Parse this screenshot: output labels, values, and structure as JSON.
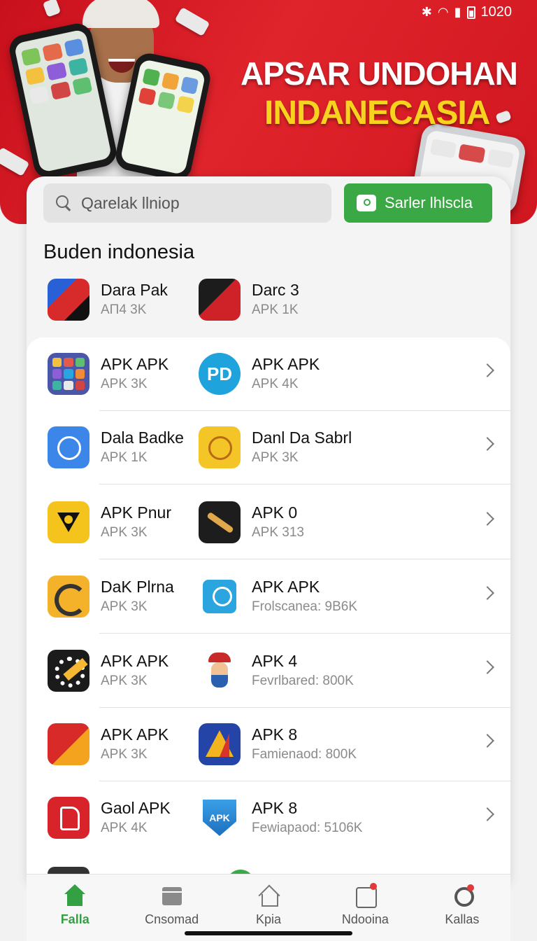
{
  "status_bar": {
    "time": "1020",
    "bluetooth_icon": "bluetooth-icon",
    "wifi_icon": "wifi-icon",
    "signal_icon": "signal-icon",
    "battery_icon": "battery-icon"
  },
  "hero": {
    "title": "APSAR UNDOHAN",
    "subtitle": "INDANECASIA",
    "accent_color": "#f7d21e",
    "background_color": "#d8161f"
  },
  "search": {
    "placeholder": "Qarelak llniop",
    "button_label": "Sarler lhlscla",
    "button_color": "#3aa844"
  },
  "section": {
    "title": "Buden indonesia"
  },
  "featured": [
    {
      "name": "Dara Pak",
      "meta": "AП4 3K",
      "icon": "red-blue-shape-icon"
    },
    {
      "name": "Darc 3",
      "meta": "APK 1K",
      "icon": "dark-red-app-icon"
    }
  ],
  "rows": [
    {
      "left": {
        "name": "APK APK",
        "meta": "APK 3K",
        "icon": "app-grid-icon"
      },
      "right": {
        "name": "APK APK",
        "meta": "APK 4K",
        "icon": "pd-logo-icon"
      }
    },
    {
      "left": {
        "name": "Dala Badke",
        "meta": "APK 1K",
        "icon": "clock-icon"
      },
      "right": {
        "name": "Danl Da Sabrl",
        "meta": "APK 3K",
        "icon": "globe-icon"
      }
    },
    {
      "left": {
        "name": "APK Pnur",
        "meta": "APK 3K",
        "icon": "shield-eye-icon"
      },
      "right": {
        "name": "APK 0",
        "meta": "APK 313",
        "icon": "brush-icon"
      }
    },
    {
      "left": {
        "name": "DaK Plrna",
        "meta": "APK 3K",
        "icon": "satellite-dish-icon"
      },
      "right": {
        "name": "APK APK",
        "meta": "Frolscanea: 9B6K",
        "icon": "tools-icon"
      }
    },
    {
      "left": {
        "name": "APK APK",
        "meta": "APK 3K",
        "icon": "gear-wrench-icon"
      },
      "right": {
        "name": "APK 4",
        "meta": "Fevrlbared: 800K",
        "icon": "character-icon"
      }
    },
    {
      "left": {
        "name": "APK APK",
        "meta": "APK 3K",
        "icon": "red-flag-app-icon"
      },
      "right": {
        "name": "APK 8",
        "meta": "Famienaod: 800K",
        "icon": "triangle-logo-icon"
      }
    },
    {
      "left": {
        "name": "Gaol APK",
        "meta": "APK 4K",
        "icon": "red-document-icon"
      },
      "right": {
        "name": "APK 8",
        "meta": "Fewiapaod: 5106K",
        "icon": "apk-shield-icon",
        "badge_text": "APK"
      }
    }
  ],
  "nav": [
    {
      "label": "Falla",
      "icon": "home-icon",
      "active": true
    },
    {
      "label": "Cnsomad",
      "icon": "box-icon"
    },
    {
      "label": "Kpia",
      "icon": "house-outline-icon"
    },
    {
      "label": "Ndooina",
      "icon": "news-icon"
    },
    {
      "label": "Kallas",
      "icon": "profile-icon"
    }
  ]
}
